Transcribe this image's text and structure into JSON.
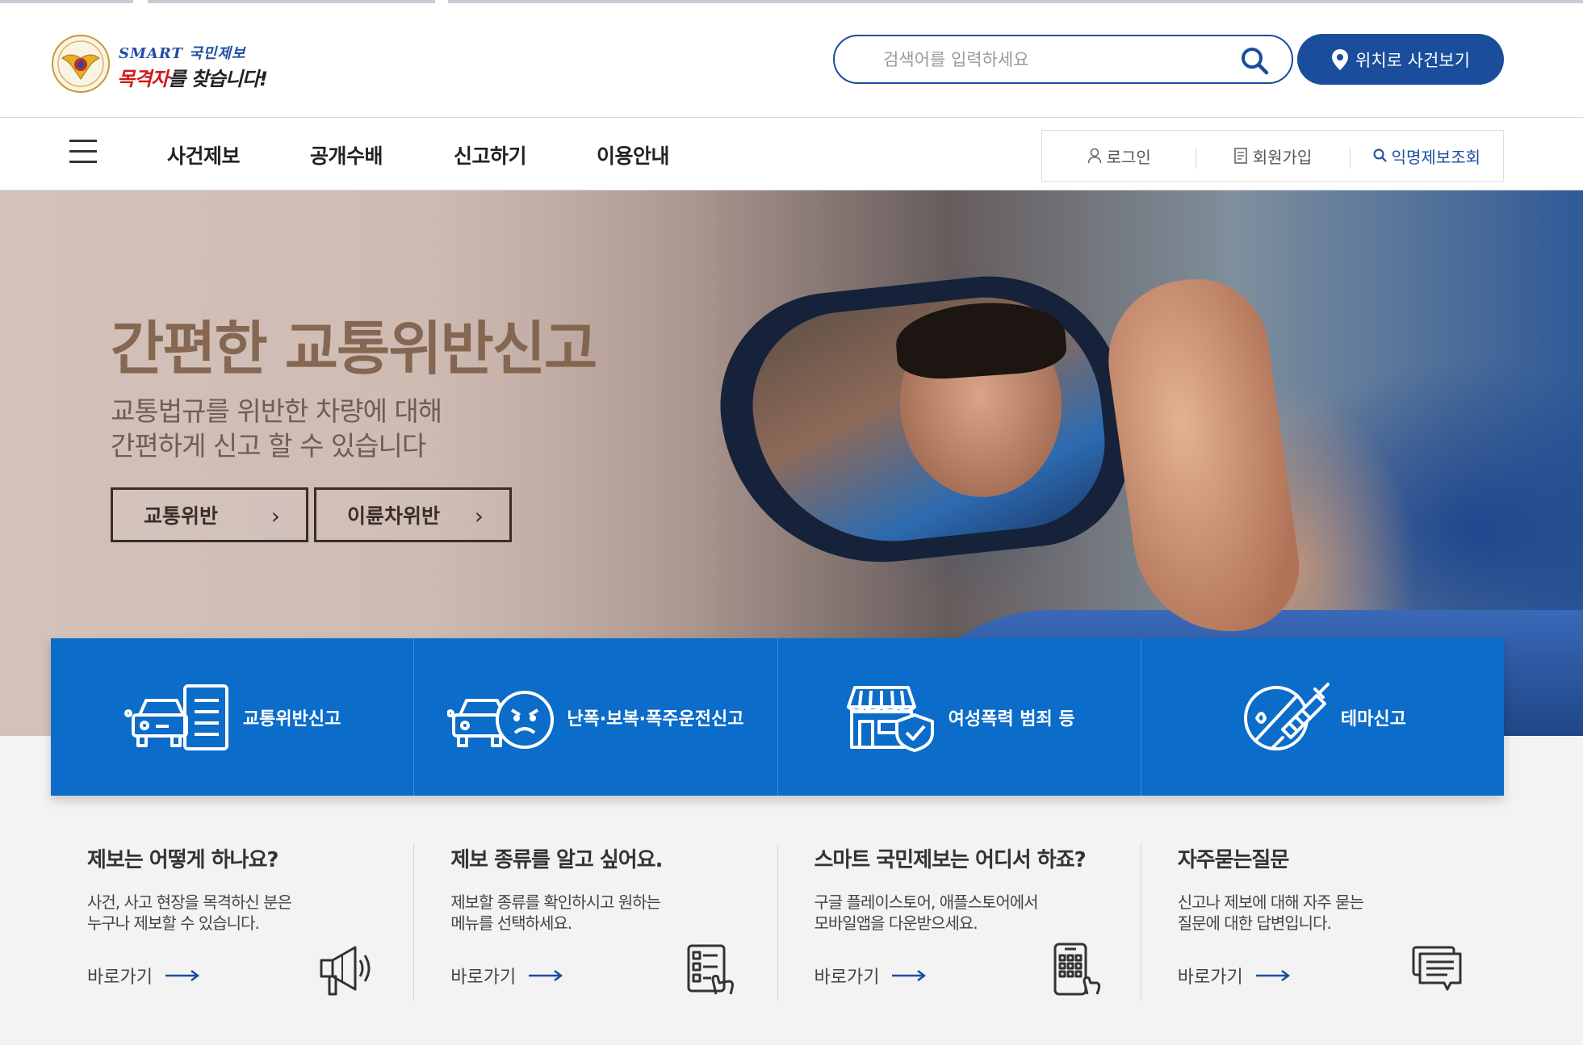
{
  "header": {
    "logo": {
      "smart_text": "SMART 국민제보",
      "tagline_highlight": "목격자",
      "tagline_rest": "를 찾습니다!"
    },
    "search": {
      "placeholder": "검색어를 입력하세요",
      "icon": "search-icon"
    },
    "location_button": {
      "label": "위치로 사건보기",
      "icon": "map-pin-icon"
    }
  },
  "nav": {
    "items": [
      "사건제보",
      "공개수배",
      "신고하기",
      "이용안내"
    ],
    "user_links": [
      {
        "label": "로그인",
        "icon": "person-icon"
      },
      {
        "label": "회원가입",
        "icon": "document-icon"
      },
      {
        "label": "익명제보조회",
        "icon": "search-icon"
      }
    ]
  },
  "hero": {
    "title": "간편한 교통위반신고",
    "subtitle_line1": "교통법규를 위반한 차량에 대해",
    "subtitle_line2": "간편하게 신고 할 수 있습니다",
    "buttons": [
      "교통위반",
      "이륜차위반"
    ]
  },
  "categories": [
    {
      "label": "교통위반신고",
      "icon": "car-document-icon"
    },
    {
      "label": "난폭·보복·폭주운전신고",
      "icon": "car-angry-face-icon"
    },
    {
      "label": "여성폭력 범죄 등",
      "icon": "store-shield-icon"
    },
    {
      "label": "테마신고",
      "icon": "syringe-prohibited-icon"
    }
  ],
  "info_cards": [
    {
      "title": "제보는 어떻게 하나요?",
      "line1": "사건, 사고 현장을 목격하신 분은",
      "line2": "누구나 제보할 수 있습니다.",
      "link": "바로가기",
      "icon": "megaphone-icon"
    },
    {
      "title": "제보 종류를 알고 싶어요.",
      "line1": "제보할 종류를 확인하시고 원하는",
      "line2": "메뉴를 선택하세요.",
      "link": "바로가기",
      "icon": "checklist-touch-icon"
    },
    {
      "title": "스마트 국민제보는 어디서 하죠?",
      "line1": "구글 플레이스토어, 애플스토어에서",
      "line2": "모바일앱을 다운받으세요.",
      "link": "바로가기",
      "icon": "mobile-phone-icon"
    },
    {
      "title": "자주묻는질문",
      "line1": "신고나 제보에 대해 자주 묻는",
      "line2": "질문에 대한 답변입니다.",
      "link": "바로가기",
      "icon": "chat-bubble-icon"
    }
  ],
  "colors": {
    "brand_blue": "#1a4d9c",
    "category_blue": "#0b6cc9",
    "lower_bg": "#f3f3f3"
  }
}
